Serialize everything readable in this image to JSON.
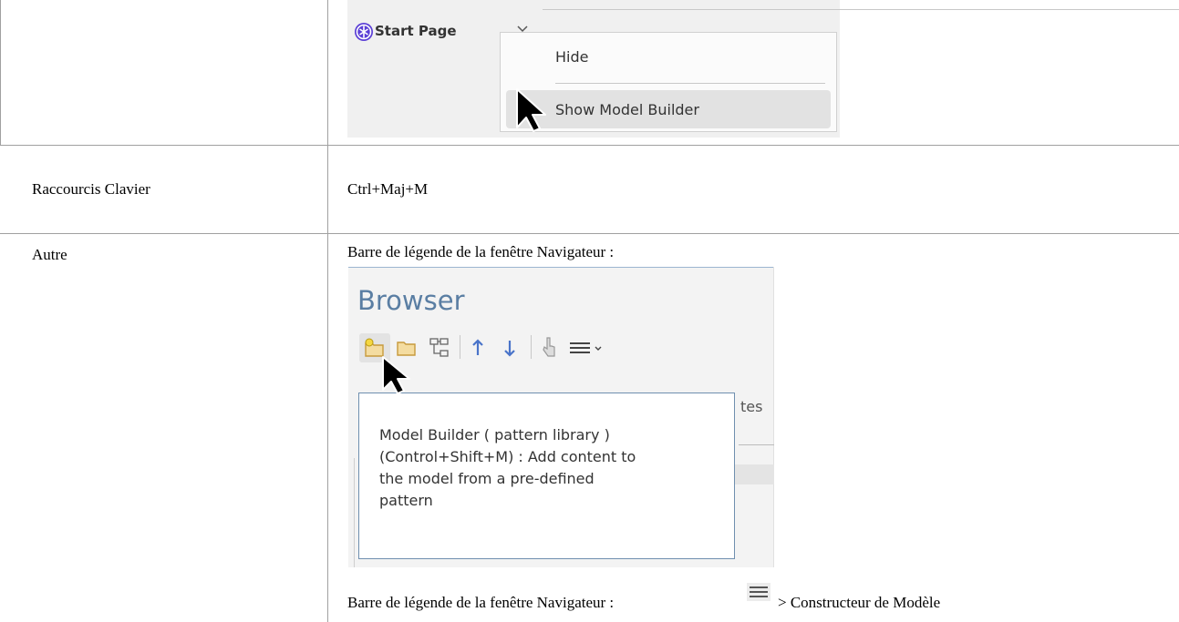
{
  "rows": [
    {
      "id": "ribbon",
      "label": "",
      "screenshot": {
        "tab_title": "Start Page",
        "tab_icon": "ea-logo-icon",
        "chevron_icon": "chevron-down-icon",
        "menu_items": [
          "Hide",
          "Show Model Builder"
        ],
        "highlighted_item": "Show Model Builder"
      }
    },
    {
      "id": "shortcut",
      "label": "Raccourcis Clavier",
      "value": "Ctrl+Maj+M"
    },
    {
      "id": "other",
      "label": "Autre",
      "line1": "Barre de légende de la fenêtre Navigateur :",
      "browser": {
        "title": "Browser",
        "toolbar_icons": [
          "new-package-icon",
          "folder-icon",
          "model-builder-icon",
          "arrow-up-icon",
          "arrow-down-icon",
          "hand-icon",
          "menu-icon"
        ],
        "obscured_text": "tes",
        "tooltip_lines": [
          "Model Builder ( pattern library )",
          "(Control+Shift+M) : Add content to",
          "the model from a pre-defined",
          "pattern"
        ]
      },
      "line2_prefix": "Barre de légende de la fenêtre Navigateur :",
      "line2_icon": "hamburger-menu-icon",
      "line2_suffix": "> Constructeur de Modèle"
    }
  ],
  "colors": {
    "border": "#a0a0a0",
    "browser_title": "#5a7ea3",
    "tooltip_border": "#6f8faf",
    "arrow_blue": "#4a74c9"
  }
}
